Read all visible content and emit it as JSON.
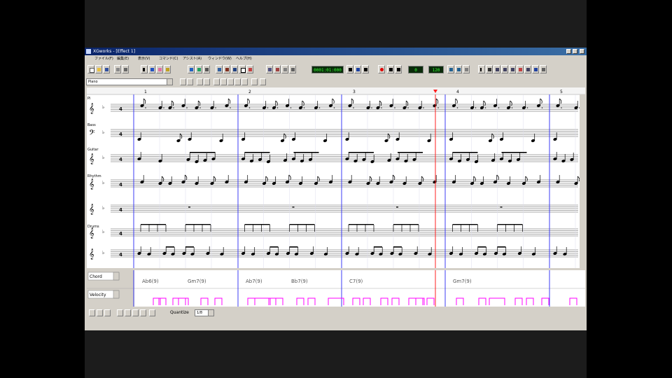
{
  "window": {
    "title": "XGworks - [Effect 1]",
    "menu": [
      "ファイル(F)",
      "編集(E)",
      "表示(V)",
      "コマンド(C)",
      "アシスト(A)",
      "ウィンドウ(W)",
      "ヘルプ(H)"
    ]
  },
  "toolbar": {
    "counter": "0001:01:000",
    "tempo_display": "0",
    "measure_display": "120"
  },
  "track_selector": {
    "value": "Piano"
  },
  "score": {
    "measures": [
      "1",
      "2",
      "3",
      "4",
      "5"
    ],
    "instruments": [
      "Pi",
      "Bass",
      "Guitar",
      "Rhythm",
      "",
      "Drums",
      ""
    ],
    "key_time": "3♭ 4/4"
  },
  "chords": [
    "Ab6(9)",
    "Gm7(9)",
    "Ab7(9)",
    "Bb7(9)",
    "C7(9)",
    "Gm7(9)"
  ],
  "lower_panel": {
    "select1": "Chord",
    "select2": "Velocity"
  },
  "status": {
    "label": "Quantize",
    "value": "1/8"
  },
  "colors": {
    "barline": "#3d3df5",
    "playhead": "#ff2020",
    "velocity": "#ff00ff",
    "titlebar": "#0a246a"
  }
}
